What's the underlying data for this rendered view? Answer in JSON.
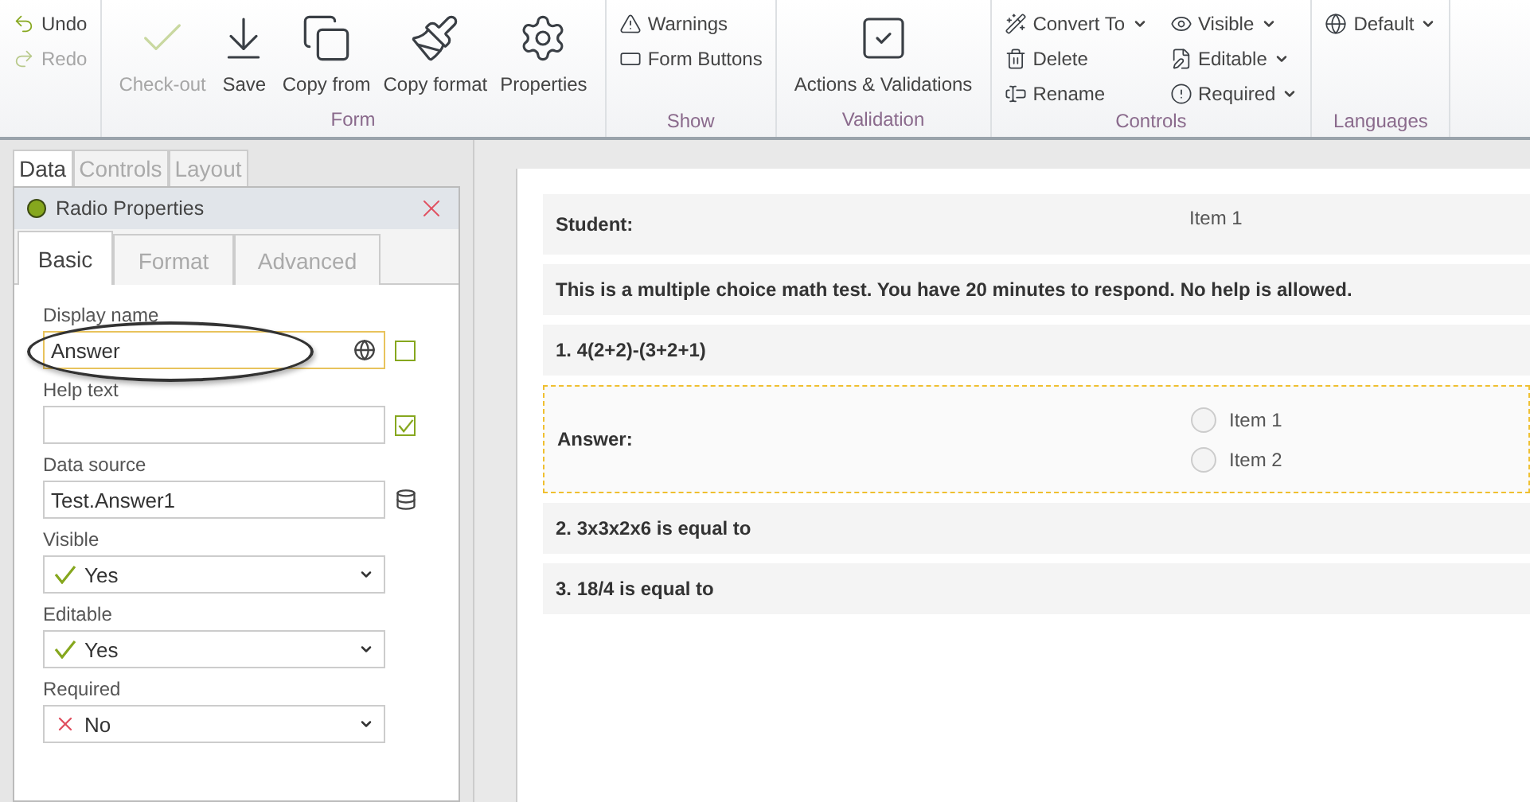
{
  "ribbon": {
    "groups": [
      {
        "items": [
          {
            "kind": "small",
            "label": "Undo",
            "disabled": false,
            "dropdown": false
          },
          {
            "kind": "small",
            "label": "Redo",
            "disabled": true,
            "dropdown": false
          }
        ]
      },
      {
        "label": "Form",
        "items": [
          {
            "kind": "large",
            "label": "Check-out",
            "disabled": true
          },
          {
            "kind": "large",
            "label": "Save",
            "disabled": false
          },
          {
            "kind": "large",
            "label": "Copy from",
            "disabled": false
          },
          {
            "kind": "large",
            "label": "Copy format",
            "disabled": false
          },
          {
            "kind": "large",
            "label": "Properties",
            "disabled": false
          }
        ]
      },
      {
        "label": "Show",
        "items": [
          {
            "kind": "small",
            "label": "Warnings",
            "disabled": false,
            "dropdown": false
          },
          {
            "kind": "small",
            "label": "Form Buttons",
            "disabled": false,
            "dropdown": false
          }
        ]
      },
      {
        "label": "Validation",
        "items": [
          {
            "kind": "large",
            "label": "Actions & Validations",
            "disabled": false
          }
        ]
      },
      {
        "label": "Controls",
        "items": [
          {
            "kind": "small",
            "label": "Convert To",
            "disabled": false,
            "dropdown": true
          },
          {
            "kind": "small",
            "label": "Delete",
            "disabled": false,
            "dropdown": false
          },
          {
            "kind": "small",
            "label": "Rename",
            "disabled": false,
            "dropdown": false
          },
          {
            "kind": "small",
            "label": "Visible",
            "disabled": false,
            "dropdown": true
          },
          {
            "kind": "small",
            "label": "Editable",
            "disabled": false,
            "dropdown": true
          },
          {
            "kind": "small",
            "label": "Required",
            "disabled": false,
            "dropdown": true
          }
        ]
      },
      {
        "label": "Languages",
        "items": [
          {
            "kind": "small",
            "label": "Default",
            "disabled": false,
            "dropdown": true
          }
        ]
      }
    ]
  },
  "side_tabs": [
    {
      "label": "Data",
      "selected": true
    },
    {
      "label": "Controls",
      "selected": false
    },
    {
      "label": "Layout",
      "selected": false
    }
  ],
  "properties": {
    "title": "Radio Properties",
    "tabs": [
      {
        "label": "Basic",
        "selected": true
      },
      {
        "label": "Format",
        "selected": false
      },
      {
        "label": "Advanced",
        "selected": false
      }
    ],
    "fields": [
      {
        "kind": "text",
        "label": "Display name",
        "value": "Answer",
        "focused": true,
        "side": {
          "kind": "checkbox",
          "checked": false
        }
      },
      {
        "kind": "text",
        "label": "Help text",
        "focused": false,
        "side": {
          "kind": "checkbox",
          "checked": true
        }
      },
      {
        "kind": "text",
        "label": "Data source",
        "value": "Test.Answer1",
        "focused": false,
        "side": {
          "kind": "database"
        }
      },
      {
        "kind": "select",
        "label": "Visible",
        "value": "Yes",
        "mark": {
          "kind": "check"
        }
      },
      {
        "kind": "select",
        "label": "Editable",
        "value": "Yes",
        "mark": {
          "kind": "check"
        }
      },
      {
        "kind": "select",
        "label": "Required",
        "value": "No",
        "mark": {
          "kind": "cross"
        }
      }
    ]
  },
  "form": {
    "rows": [
      {
        "kind": "field",
        "label": "Student:",
        "value": "Item 1"
      },
      {
        "kind": "text",
        "text": "This is a multiple choice math test. You have 20 minutes to respond. No help is allowed."
      },
      {
        "kind": "text",
        "text": "1. 4(2+2)-(3+2+1)"
      },
      {
        "kind": "radio",
        "label": "Answer:",
        "selected": true,
        "options": [
          {
            "label": "Item 1",
            "selected": false
          },
          {
            "label": "Item 2",
            "selected": false
          }
        ]
      },
      {
        "kind": "text",
        "text": "2. 3x3x2x6 is equal to"
      },
      {
        "kind": "text",
        "text": "3. 18/4 is equal to"
      }
    ]
  }
}
